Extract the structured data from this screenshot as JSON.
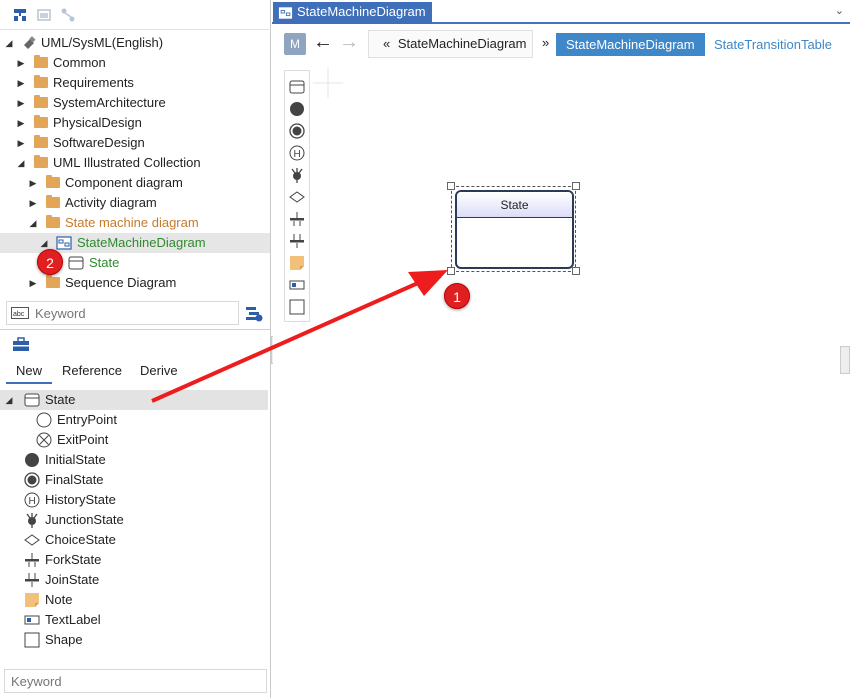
{
  "tree": {
    "root_label": "UML/SysML(English)",
    "items": [
      {
        "label": "Common"
      },
      {
        "label": "Requirements"
      },
      {
        "label": "SystemArchitecture"
      },
      {
        "label": "PhysicalDesign"
      },
      {
        "label": "SoftwareDesign"
      },
      {
        "label": "UML Illustrated Collection"
      },
      {
        "label": "Component diagram"
      },
      {
        "label": "Activity diagram"
      },
      {
        "label": "State machine diagram"
      },
      {
        "label": "StateMachineDiagram"
      },
      {
        "label": "State"
      },
      {
        "label": "Sequence Diagram"
      }
    ],
    "keyword_placeholder": "Keyword"
  },
  "palette": {
    "tabs": [
      "New",
      "Reference",
      "Derive"
    ],
    "active_tab": "New",
    "items": [
      {
        "label": "State",
        "icon": "state-icon"
      },
      {
        "label": "EntryPoint",
        "icon": "entry-point-icon"
      },
      {
        "label": "ExitPoint",
        "icon": "exit-point-icon"
      },
      {
        "label": "InitialState",
        "icon": "initial-state-icon"
      },
      {
        "label": "FinalState",
        "icon": "final-state-icon"
      },
      {
        "label": "HistoryState",
        "icon": "history-state-icon"
      },
      {
        "label": "JunctionState",
        "icon": "junction-state-icon"
      },
      {
        "label": "ChoiceState",
        "icon": "choice-state-icon"
      },
      {
        "label": "ForkState",
        "icon": "fork-state-icon"
      },
      {
        "label": "JoinState",
        "icon": "join-state-icon"
      },
      {
        "label": "Note",
        "icon": "note-icon"
      },
      {
        "label": "TextLabel",
        "icon": "text-label-icon"
      },
      {
        "label": "Shape",
        "icon": "shape-icon"
      }
    ],
    "keyword_placeholder": "Keyword"
  },
  "editor": {
    "tab_title": "StateMachineDiagram",
    "model_button": "M",
    "breadcrumb_prefix": "«",
    "breadcrumb_item": "StateMachineDiagram",
    "breadcrumb_sep": "»",
    "view_active": "StateMachineDiagram",
    "view_other": "StateTransitionTable"
  },
  "diagram": {
    "state_name": "State"
  },
  "annotations": {
    "badge1": "1",
    "badge2": "2"
  },
  "colors": {
    "accent": "#3e6fb8",
    "folder": "#e3a658",
    "badge": "#e02020",
    "arrow": "#ee1c1c"
  }
}
